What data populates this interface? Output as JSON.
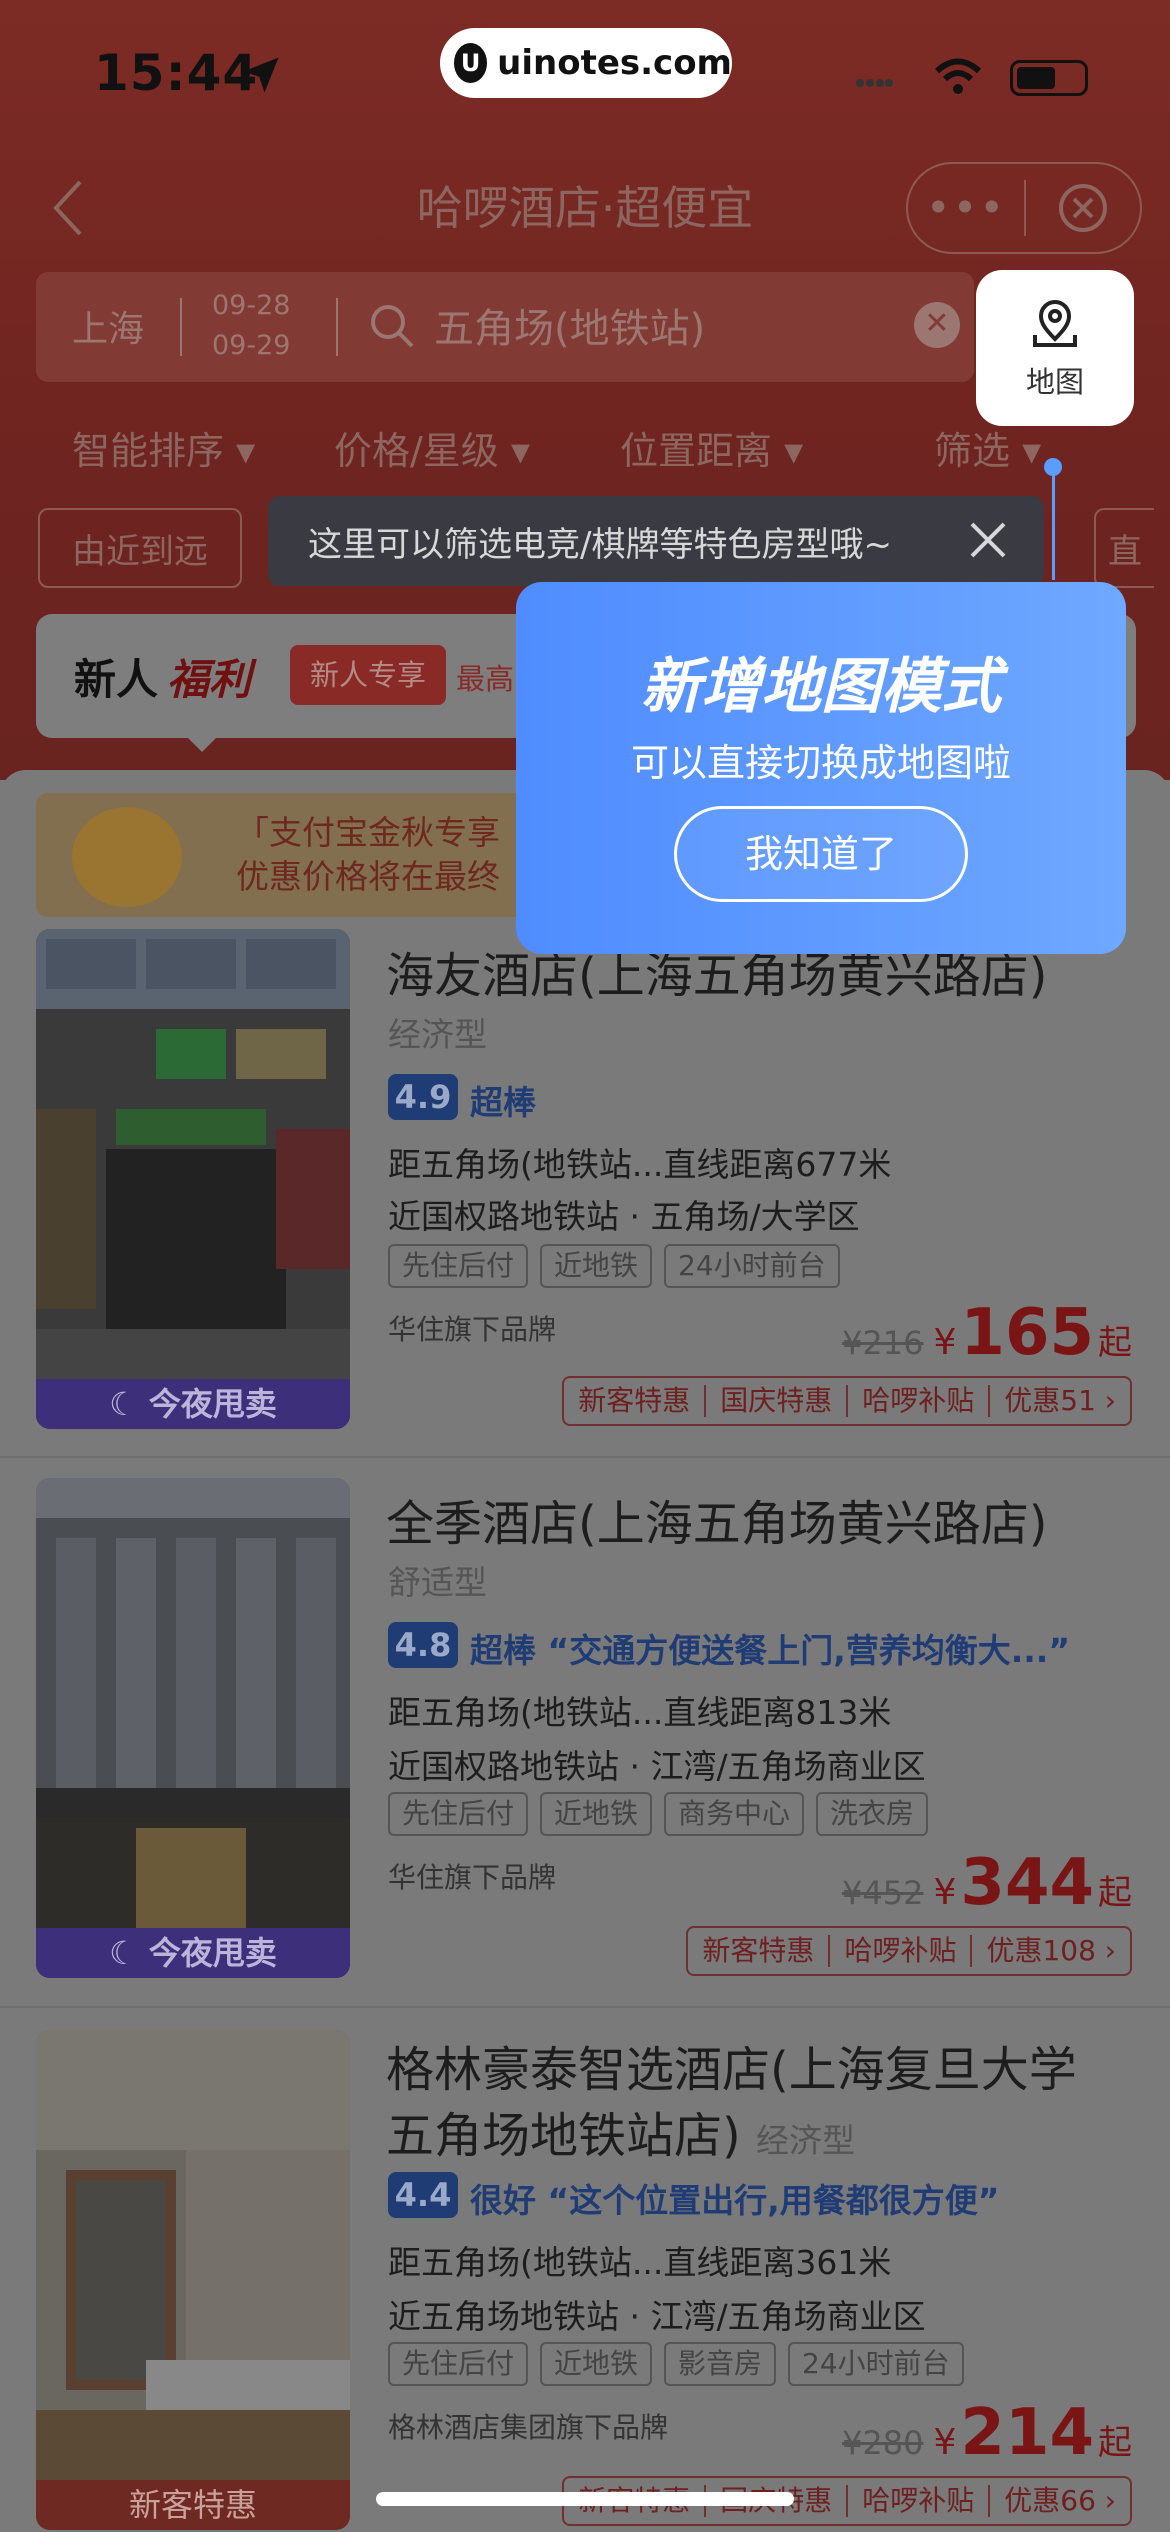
{
  "status": {
    "time": "15:44"
  },
  "watermark": "uinotes.com",
  "header": {
    "title": "哈啰酒店·超便宜",
    "more": "•••"
  },
  "search": {
    "city": "上海",
    "checkin": "09-28",
    "checkout": "09-29",
    "keyword": "五角场(地铁站)",
    "map_label": "地图"
  },
  "filters": [
    "智能排序",
    "价格/星级",
    "位置距离",
    "筛选"
  ],
  "chips": [
    "由近到远",
    "直"
  ],
  "tooltip": "这里可以筛选电竞/棋牌等特色房型哦~",
  "newbie": {
    "a": "新人",
    "b": "福利",
    "tag": "新人专享",
    "rest": "最高"
  },
  "promo": {
    "line1": "「支付宝金秋专享",
    "line2": "优惠价格将在最终"
  },
  "popup": {
    "title": "新增地图模式",
    "subtitle": "可以直接切换成地图啦",
    "button": "我知道了"
  },
  "hotels": [
    {
      "name": "海友酒店(上海五角场黄兴路店)",
      "type": "经济型",
      "rating": "4.9",
      "rating_word": "超棒",
      "review": "",
      "distance": "距五角场(地铁站...直线距离677米",
      "area": "近国权路地铁站 · 五角场/大学区",
      "tags": [
        "先住后付",
        "近地铁",
        "24小时前台"
      ],
      "brand": "华住旗下品牌",
      "old_price": "¥216",
      "currency": "¥",
      "price": "165",
      "price_suffix": "起",
      "discounts": [
        "新客特惠",
        "国庆特惠",
        "哈啰补贴",
        "优惠51 ›"
      ],
      "banner": "☾ 今夜甩卖"
    },
    {
      "name": "全季酒店(上海五角场黄兴路店)",
      "type": "舒适型",
      "rating": "4.8",
      "rating_word": "超棒",
      "review": "“交通方便送餐上门,营养均衡大...”",
      "distance": "距五角场(地铁站...直线距离813米",
      "area": "近国权路地铁站 · 江湾/五角场商业区",
      "tags": [
        "先住后付",
        "近地铁",
        "商务中心",
        "洗衣房"
      ],
      "brand": "华住旗下品牌",
      "old_price": "¥452",
      "currency": "¥",
      "price": "344",
      "price_suffix": "起",
      "discounts": [
        "新客特惠",
        "哈啰补贴",
        "优惠108 ›"
      ],
      "banner": "☾ 今夜甩卖"
    },
    {
      "name": "格林豪泰智选酒店(上海复旦大学",
      "name2": "五角场地铁站店)",
      "type": "经济型",
      "rating": "4.4",
      "rating_word": "很好",
      "review": "“这个位置出行,用餐都很方便”",
      "distance": "距五角场(地铁站...直线距离361米",
      "area": "近五角场地铁站 · 江湾/五角场商业区",
      "tags": [
        "先住后付",
        "近地铁",
        "影音房",
        "24小时前台"
      ],
      "brand": "格林酒店集团旗下品牌",
      "old_price": "¥280",
      "currency": "¥",
      "price": "214",
      "price_suffix": "起",
      "discounts": [
        "新客特惠",
        "国庆特惠",
        "哈啰补贴",
        "优惠66 ›"
      ],
      "banner": "新客特惠"
    }
  ]
}
